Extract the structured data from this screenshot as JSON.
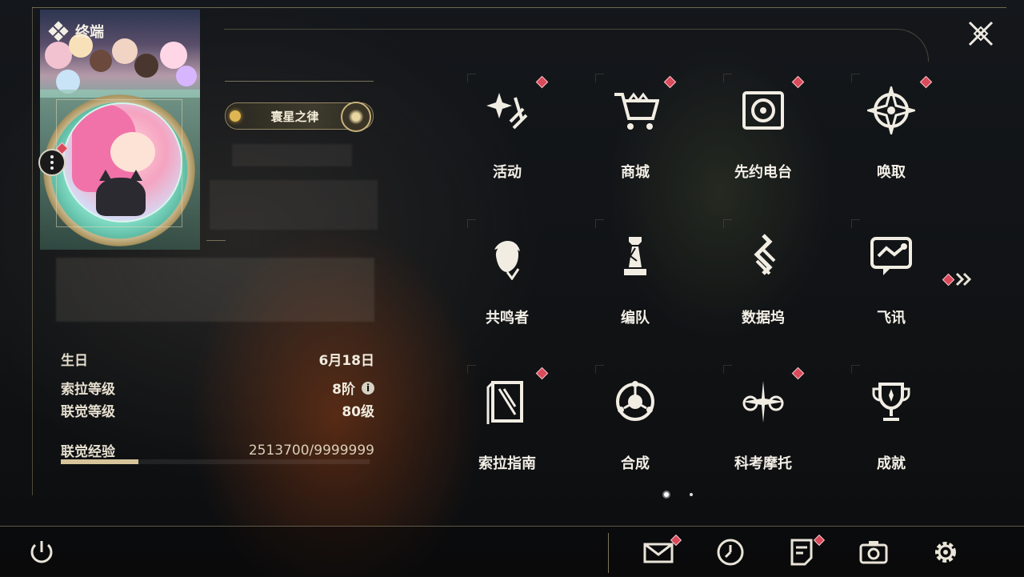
{
  "header": {
    "title": "终端"
  },
  "profile": {
    "title_badge": "寰星之律",
    "stats": [
      {
        "label": "生日",
        "value": "6月18日"
      },
      {
        "label": "索拉等级",
        "value": "8阶"
      },
      {
        "label": "联觉等级",
        "value": "80级"
      },
      {
        "label": "联觉经验",
        "value": "2513700/9999999"
      }
    ],
    "exp_progress": 0.2514
  },
  "menu": {
    "items": [
      {
        "label": "活动",
        "icon": "sparkle-icon",
        "badge": true
      },
      {
        "label": "商城",
        "icon": "shopping-cart-icon",
        "badge": true
      },
      {
        "label": "先约电台",
        "icon": "radio-icon",
        "badge": true
      },
      {
        "label": "唤取",
        "icon": "compass-star-icon",
        "badge": true
      },
      {
        "label": "共鸣者",
        "icon": "character-head-icon",
        "badge": false
      },
      {
        "label": "编队",
        "icon": "chess-piece-icon",
        "badge": false
      },
      {
        "label": "数据坞",
        "icon": "data-dock-icon",
        "badge": false
      },
      {
        "label": "飞讯",
        "icon": "chat-bubble-icon",
        "badge": false
      },
      {
        "label": "索拉指南",
        "icon": "guidebook-icon",
        "badge": true
      },
      {
        "label": "合成",
        "icon": "synthesis-icon",
        "badge": false
      },
      {
        "label": "科考摩托",
        "icon": "motorcycle-icon",
        "badge": true
      },
      {
        "label": "成就",
        "icon": "trophy-icon",
        "badge": false
      }
    ],
    "page_count": 2,
    "current_page": 1
  },
  "bottom_bar": {
    "icons": [
      "power-icon",
      "mail-icon",
      "clock-icon",
      "notes-icon",
      "camera-icon",
      "settings-gear-icon"
    ]
  },
  "colors": {
    "accent_gold": "#c8b58a",
    "badge_red": "#d94a5a",
    "text": "#f3efe6"
  }
}
